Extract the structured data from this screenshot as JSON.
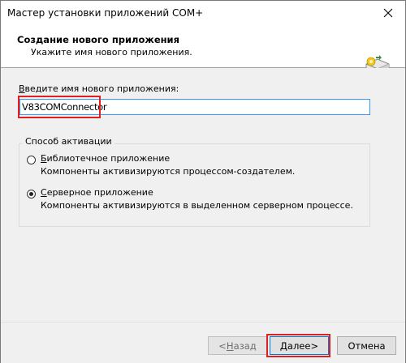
{
  "window": {
    "title": "Мастер установки приложений COM+"
  },
  "header": {
    "title": "Создание нового приложения",
    "subtitle": "Укажите имя нового приложения."
  },
  "form": {
    "name_label_accel": "В",
    "name_label_rest": "ведите имя нового приложения:",
    "name_value": "V83COMConnector"
  },
  "activation": {
    "group_label": "Способ активации",
    "options": [
      {
        "accel": "Б",
        "label_rest": "иблиотечное приложение",
        "desc": "Компоненты активизируются процессом-создателем.",
        "selected": false
      },
      {
        "accel": "С",
        "label_rest": "ерверное приложение",
        "desc": "Компоненты активизируются в выделенном серверном процессе.",
        "selected": true
      }
    ]
  },
  "buttons": {
    "back_arrow": "< ",
    "back_accel": "Н",
    "back_rest": "азад",
    "next_accel": "Д",
    "next_rest": "алее",
    "next_arrow": " >",
    "cancel": "Отмена"
  },
  "colors": {
    "highlight": "#e02020",
    "focus": "#0078d7",
    "face": "#f0f0f0"
  }
}
